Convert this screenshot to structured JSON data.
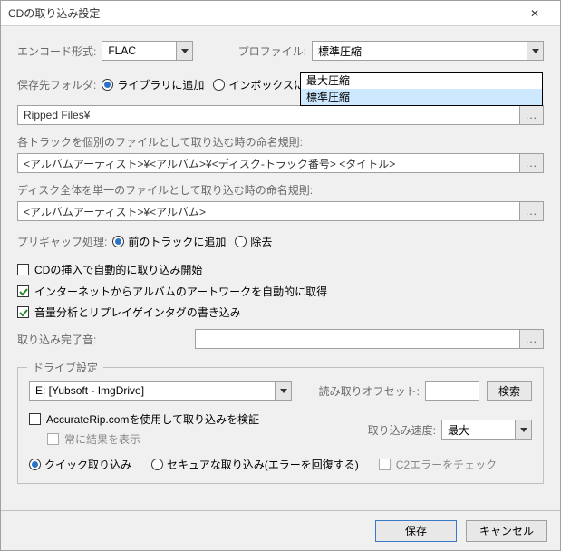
{
  "title": "CDの取り込み設定",
  "encode": {
    "label": "エンコード形式:",
    "value": "FLAC"
  },
  "profile": {
    "label": "プロファイル:",
    "value": "標準圧縮",
    "options": [
      "最大圧縮",
      "標準圧縮"
    ],
    "highlighted": 1
  },
  "saveFolder": {
    "label": "保存先フォルダ:",
    "radioLibrary": "ライブラリに追加",
    "radioInbox": "インボックスに追",
    "path": "Ripped Files¥"
  },
  "trackNaming": {
    "label": "各トラックを個別のファイルとして取り込む時の命名規則:",
    "value": "<アルバムアーティスト>¥<アルバム>¥<ディスク-トラック番号> <タイトル>"
  },
  "discNaming": {
    "label": "ディスク全体を単一のファイルとして取り込む時の命名規則:",
    "value": "<アルバムアーティスト>¥<アルバム>"
  },
  "pregap": {
    "label": "プリギャップ処理:",
    "radioAppend": "前のトラックに追加",
    "radioRemove": "除去"
  },
  "checks": {
    "autoRip": "CDの挿入で自動的に取り込み開始",
    "artwork": "インターネットからアルバムのアートワークを自動的に取得",
    "replaygain": "音量分析とリプレイゲインタグの書き込み"
  },
  "completeSound": {
    "label": "取り込み完了音:",
    "value": ""
  },
  "drive": {
    "legend": "ドライブ設定",
    "name": "E: [Yubsoft - ImgDrive]",
    "offsetLabel": "読み取りオフセット:",
    "searchBtn": "検索",
    "accurateRip": "AccurateRip.comを使用して取り込みを検証",
    "alwaysShow": "常に結果を表示",
    "speedLabel": "取り込み速度:",
    "speedValue": "最大",
    "quick": "クイック取り込み",
    "secure": "セキュアな取り込み(エラーを回復する)",
    "c2": "C2エラーをチェック"
  },
  "footer": {
    "save": "保存",
    "cancel": "キャンセル"
  },
  "browse": "..."
}
